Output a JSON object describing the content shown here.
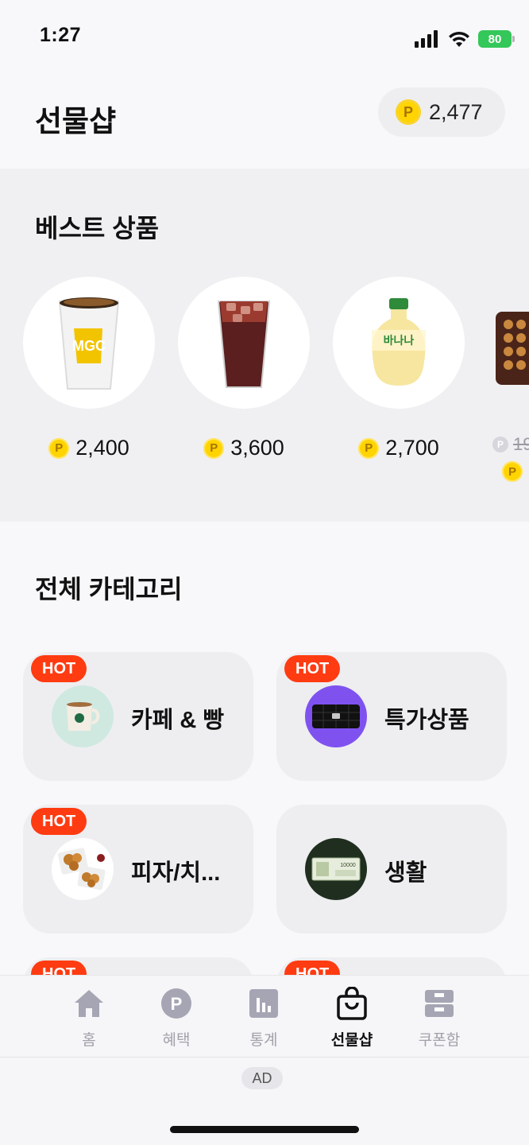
{
  "status": {
    "time": "1:27",
    "battery": "80"
  },
  "header": {
    "title": "선물샵",
    "point_balance": "2,477"
  },
  "coin_symbol": "P",
  "best": {
    "title": "베스트 상품",
    "items": [
      {
        "price": "2,400",
        "icon": "coffee-cup-icon"
      },
      {
        "price": "3,600",
        "icon": "iced-tea-icon"
      },
      {
        "price": "2,700",
        "icon": "banana-milk-icon"
      },
      {
        "price": "19",
        "icon": "gift-box-icon",
        "strike": true
      }
    ]
  },
  "category": {
    "title": "전체 카테고리",
    "hot_label": "HOT",
    "items": [
      {
        "label": "카페 & 빵",
        "hot": true,
        "icon": "coffee-mug-icon",
        "bg": "#cfe9e1"
      },
      {
        "label": "특가상품",
        "hot": true,
        "icon": "wallet-icon",
        "bg": "#7f52f0"
      },
      {
        "label": "피자/치...",
        "hot": true,
        "icon": "fried-chicken-icon",
        "bg": "#ffffff"
      },
      {
        "label": "생활",
        "hot": false,
        "icon": "banknote-icon",
        "bg": "#1f2e1e"
      }
    ]
  },
  "tabs": [
    {
      "label": "홈",
      "icon": "home-icon"
    },
    {
      "label": "혜택",
      "icon": "point-icon"
    },
    {
      "label": "통계",
      "icon": "stats-icon"
    },
    {
      "label": "선물샵",
      "icon": "shopping-bag-icon",
      "active": true
    },
    {
      "label": "쿠폰함",
      "icon": "coupon-box-icon"
    }
  ],
  "ad_label": "AD",
  "colors": {
    "hot": "#ff3b12",
    "coin": "#ffd400",
    "active_tab": "#111111",
    "inactive_tab": "#a1a1aa"
  }
}
